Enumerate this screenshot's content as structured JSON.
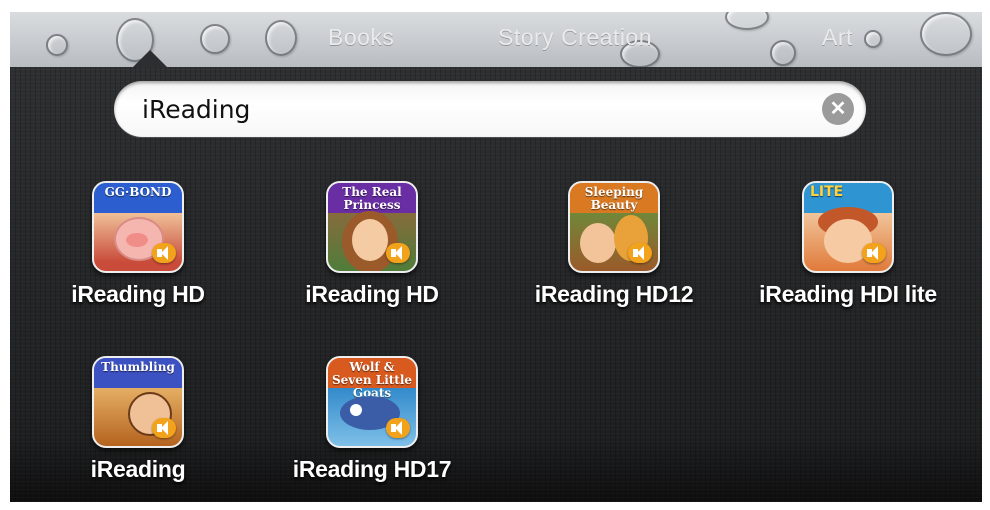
{
  "folder_tabs": [
    {
      "label": "Books"
    },
    {
      "label": "Story Creation"
    },
    {
      "label": "Art"
    }
  ],
  "search": {
    "value": "iReading",
    "clear_icon": "clear-icon"
  },
  "apps": [
    {
      "label": "iReading HD",
      "cover_title": "GG·BOND"
    },
    {
      "label": "iReading HD",
      "cover_title": "The Real Princess"
    },
    {
      "label": "iReading HD12",
      "cover_title": "Sleeping Beauty"
    },
    {
      "label": "iReading HDI lite",
      "cover_title": "LITE"
    },
    {
      "label": "iReading",
      "cover_title": "Thumbling"
    },
    {
      "label": "iReading HD17",
      "cover_title": "Wolf & Seven Little Goats"
    }
  ],
  "colors": {
    "panel": "#252627",
    "sound_badge": "#f3a21b"
  }
}
